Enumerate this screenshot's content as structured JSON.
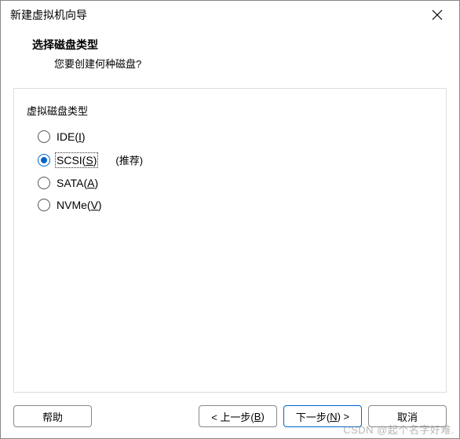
{
  "window": {
    "title": "新建虚拟机向导"
  },
  "header": {
    "heading": "选择磁盘类型",
    "subheading": "您要创建何种磁盘?"
  },
  "group": {
    "label": "虚拟磁盘类型",
    "recommend": "(推荐)",
    "options": [
      {
        "pre": "IDE(",
        "mn": "I",
        "post": ")",
        "checked": false
      },
      {
        "pre": "SCSI(",
        "mn": "S",
        "post": ")",
        "checked": true
      },
      {
        "pre": "SATA(",
        "mn": "A",
        "post": ")",
        "checked": false
      },
      {
        "pre": "NVMe(",
        "mn": "V",
        "post": ")",
        "checked": false
      }
    ]
  },
  "buttons": {
    "help": "帮助",
    "back_pre": "< 上一步(",
    "back_mn": "B",
    "back_post": ")",
    "next_pre": "下一步(",
    "next_mn": "N",
    "next_post": ") >",
    "cancel": "取消"
  },
  "watermark": "CSDN @起个名字好难."
}
